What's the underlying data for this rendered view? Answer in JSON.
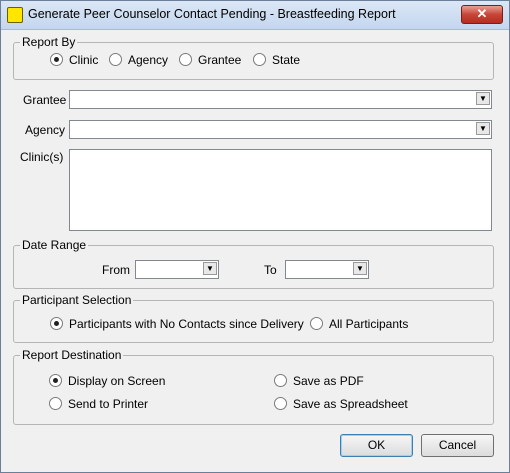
{
  "window": {
    "title": "Generate Peer Counselor Contact Pending - Breastfeeding Report",
    "close_label": "✕"
  },
  "report_by": {
    "legend": "Report By",
    "options": [
      "Clinic",
      "Agency",
      "Grantee",
      "State"
    ],
    "selected": "Clinic"
  },
  "fields": {
    "grantee_label": "Grantee",
    "agency_label": "Agency",
    "clinics_label": "Clinic(s)"
  },
  "date_range": {
    "legend": "Date Range",
    "from_label": "From",
    "to_label": "To"
  },
  "participant_selection": {
    "legend": "Participant Selection",
    "option1": "Participants with No Contacts since Delivery",
    "option2": "All Participants",
    "selected": "Participants with No Contacts since Delivery"
  },
  "report_destination": {
    "legend": "Report Destination",
    "display": "Display on Screen",
    "printer": "Send to Printer",
    "pdf": "Save as PDF",
    "spreadsheet": "Save as Spreadsheet",
    "selected": "Display on Screen"
  },
  "buttons": {
    "ok": "OK",
    "cancel": "Cancel"
  },
  "icons": {
    "title": "app-icon",
    "dropdown": "chevron-down-icon"
  },
  "colors": {
    "dialog_bg": "#f0f0f0",
    "close_red": "#c7453a",
    "title_gradient": "#dbe7f6"
  }
}
